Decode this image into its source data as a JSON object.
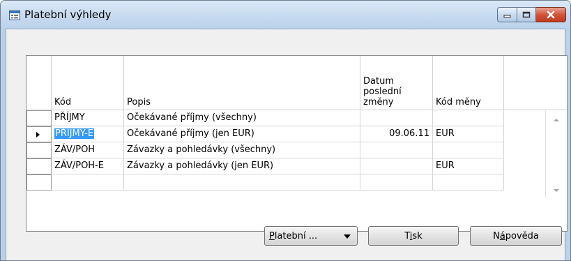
{
  "window": {
    "title": "Platební výhledy"
  },
  "table": {
    "headers": {
      "code": "Kód",
      "description": "Popis",
      "last_modified": "Datum\nposlední\nzměny",
      "currency": "Kód měny"
    },
    "rows": [
      {
        "code": "PŘÍJMY",
        "description": "Očekávané příjmy (všechny)",
        "last_modified": "",
        "currency": "",
        "selected": false
      },
      {
        "code": "PŘÍJMY-E",
        "description": "Očekávané příjmy (jen EUR)",
        "last_modified": "09.06.11",
        "currency": "EUR",
        "selected": true
      },
      {
        "code": "ZÁV/POH",
        "description": "Závazky a pohledávky (všechny)",
        "last_modified": "",
        "currency": "",
        "selected": false
      },
      {
        "code": "ZÁV/POH-E",
        "description": "Závazky a pohledávky (jen EUR)",
        "last_modified": "",
        "currency": "EUR",
        "selected": false
      },
      {
        "code": "",
        "description": "",
        "last_modified": "",
        "currency": "",
        "selected": false
      }
    ]
  },
  "buttons": {
    "payment": {
      "label_underlined": "P",
      "label_rest": "latební ..."
    },
    "print": {
      "label_pre": "T",
      "label_underlined": "i",
      "label_rest": "sk"
    },
    "help": {
      "label_pre": "N",
      "label_underlined": "á",
      "label_rest": "pověda"
    }
  },
  "colors": {
    "selection": "#3399ff",
    "close_button": "#c23a1d",
    "window_frame": "#b9d1ea"
  },
  "icons": {
    "title": "form-window-icon",
    "minimize": "minimize-icon",
    "maximize": "maximize-icon",
    "close": "close-icon"
  }
}
